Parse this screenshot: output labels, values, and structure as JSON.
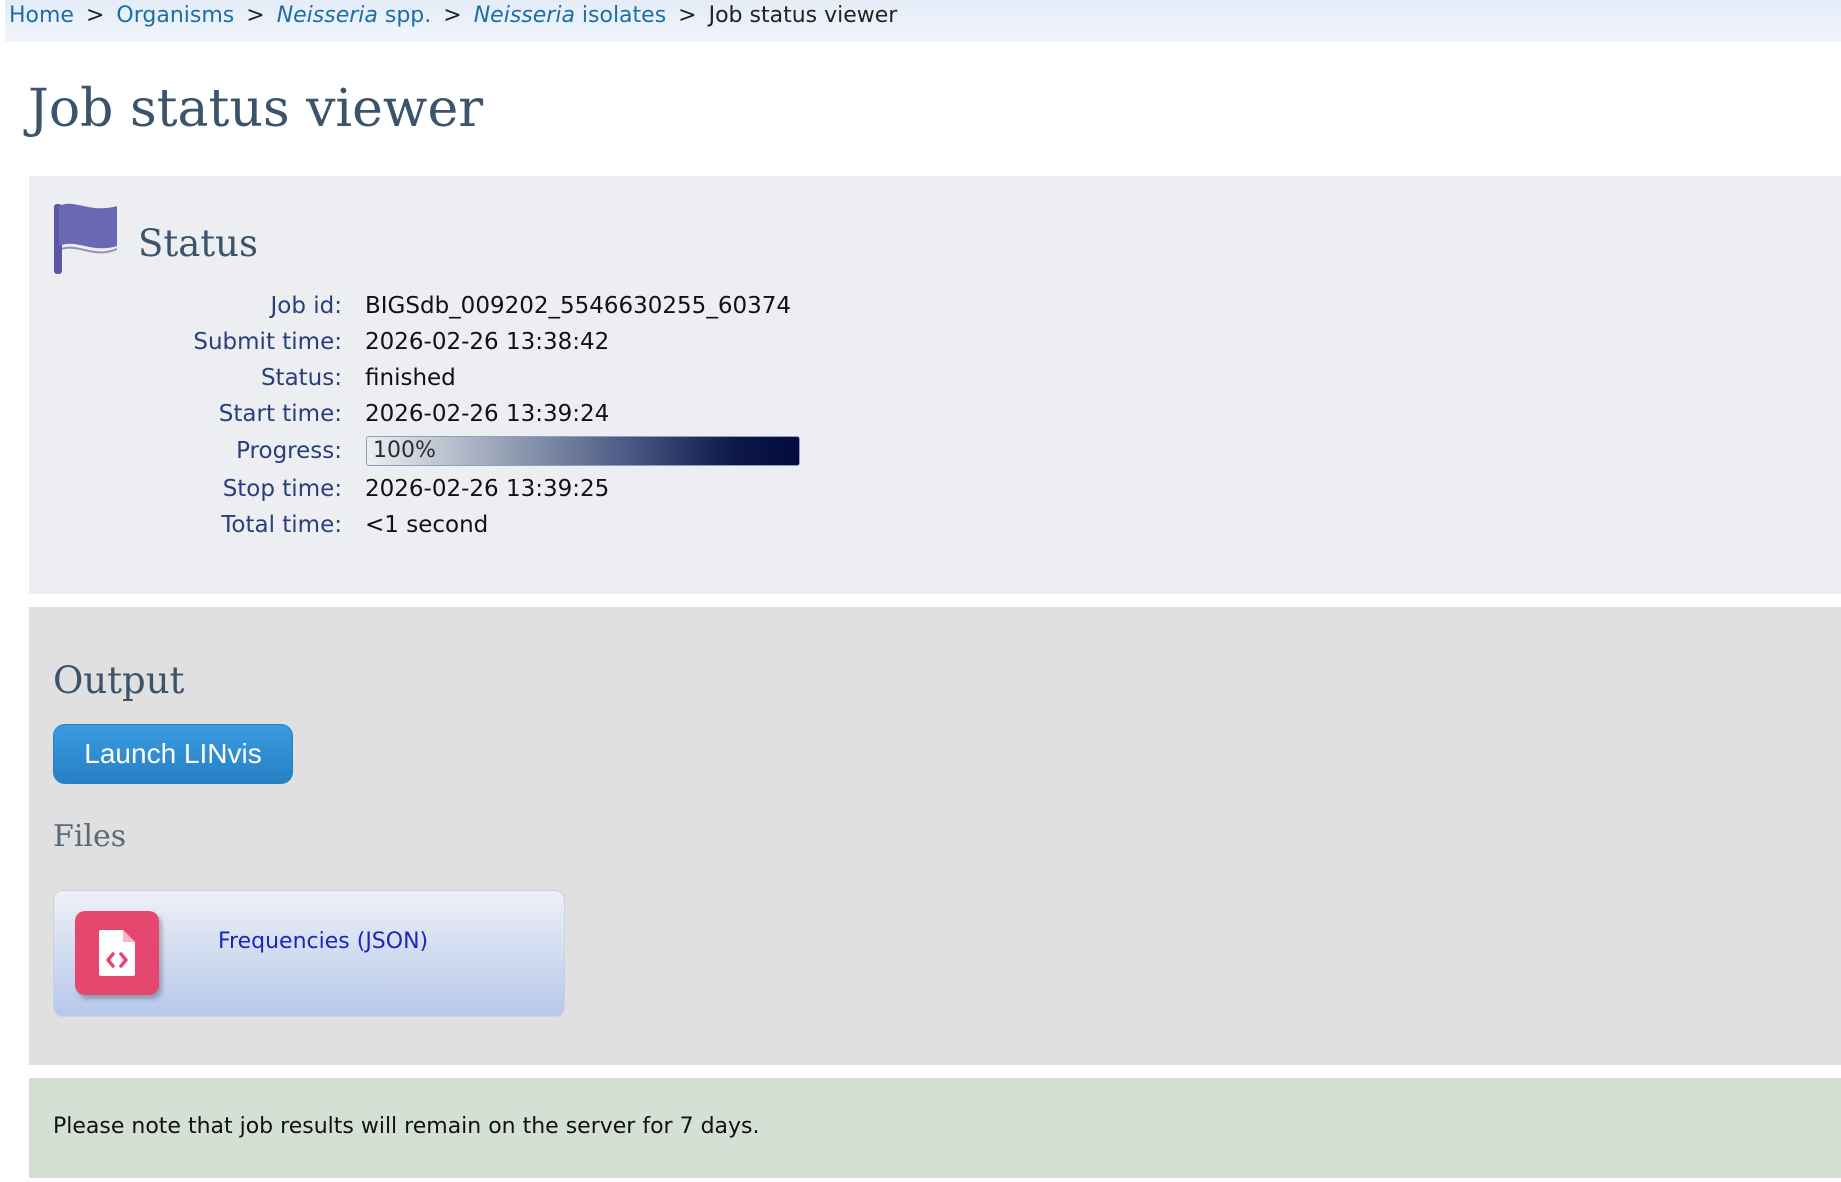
{
  "breadcrumb": {
    "home": "Home",
    "organisms": "Organisms",
    "species_italic": "Neisseria",
    "species_rest": " spp.",
    "isolates_italic": "Neisseria",
    "isolates_rest": " isolates",
    "current": "Job status viewer",
    "separator": ">"
  },
  "page_title": "Job status viewer",
  "status": {
    "heading": "Status",
    "icon": "flag-icon",
    "rows": [
      {
        "label": "Job id:",
        "value": "BIGSdb_009202_5546630255_60374"
      },
      {
        "label": "Submit time:",
        "value": "2026-02-26 13:38:42"
      },
      {
        "label": "Status:",
        "value": "finished"
      },
      {
        "label": "Start time:",
        "value": "2026-02-26 13:39:24"
      },
      {
        "label": "Progress:",
        "value": "100%"
      },
      {
        "label": "Stop time:",
        "value": "2026-02-26 13:39:25"
      },
      {
        "label": "Total time:",
        "value": "<1 second"
      }
    ],
    "progress_percent": 100
  },
  "output": {
    "heading": "Output",
    "launch_button": "Launch LINvis",
    "files_heading": "Files",
    "files": [
      {
        "label": "Frequencies (JSON)",
        "icon": "json-file-icon"
      }
    ]
  },
  "note": "Please note that job results will remain on the server for 7 days.",
  "colors": {
    "heading": "#3c536c",
    "label": "#2a3f7a",
    "link": "#1b6fa6",
    "flag": "#6a67b4",
    "file_icon_bg": "#e6476e",
    "button": "#2f8dd2"
  }
}
